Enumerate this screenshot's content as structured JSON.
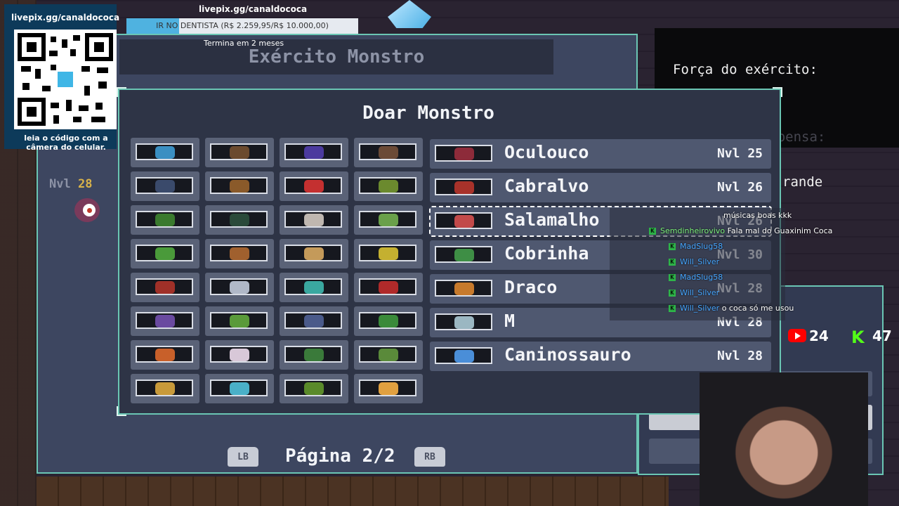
{
  "stream_overlay": {
    "qr_url": "livepix.gg/canaldococa",
    "qr_caption": "leia o código com a câmera do celular.",
    "goal_url": "livepix.gg/canaldococa",
    "goal_text": "IR NO DENTISTA (R$ 2.259,95/R$ 10.000,00)",
    "goal_progress": 0.226,
    "goal_ends": "Termina em 2 meses",
    "youtube_viewers": "24",
    "kick_viewers": "47",
    "colors": {
      "youtube": "#ff0000",
      "kick": "#53fc18",
      "goal_fill": "#4fb2e0"
    }
  },
  "chat": [
    {
      "user": "",
      "message": "músicas boas kkk"
    },
    {
      "user": "Semdinheirovivo",
      "message": "Fala mal do Guaxinim Coca"
    },
    {
      "user": "MadSlug58",
      "message": ""
    },
    {
      "user": "Will_Silver",
      "message": ""
    },
    {
      "user": "MadSlug58",
      "message": ""
    },
    {
      "user": "Will_Silver",
      "message": ""
    },
    {
      "user": "Will_Silver",
      "message": "o coca só me usou"
    }
  ],
  "game": {
    "outer_title": "Exército Monstro",
    "dialog_title": "Doar Monstro",
    "hero_level_label": "Nvl",
    "hero_level_value": "28",
    "page_label": "Página 2/2",
    "lb_label": "LB",
    "rb_label": "RB",
    "side_panel": {
      "force_label": "Força do exército:",
      "next_reward_label": "Próxima recompensa:",
      "partial_text": "rande"
    },
    "monster_list": [
      {
        "name": "Oculouco",
        "level": "Nvl 25",
        "color": "#8d2b3a"
      },
      {
        "name": "Cabralvo",
        "level": "Nvl 26",
        "color": "#a8322a"
      },
      {
        "name": "Salamalho",
        "level": "Nvl 26",
        "color": "#c24a4a"
      },
      {
        "name": "Cobrinha",
        "level": "Nvl 30",
        "color": "#3e8e45"
      },
      {
        "name": "Draco",
        "level": "Nvl 28",
        "color": "#c77a2c"
      },
      {
        "name": "M",
        "level": "Nvl 28",
        "color": "#9bb7c2"
      },
      {
        "name": "Caninossauro",
        "level": "Nvl 28",
        "color": "#4a8ed8"
      }
    ],
    "grid_sprites": [
      [
        "#3a8fc2",
        "#6b4a2e",
        "#4b3a9e",
        "#6b4a36"
      ],
      [
        "#3a4a6b",
        "#8a5a2a",
        "#c43030",
        "#6b8a2e"
      ],
      [
        "#3a7a2e",
        "#2a4a3a",
        "#bfb7b0",
        "#6aa04a"
      ],
      [
        "#4a9a3a",
        "#a0602e",
        "#c49a5a",
        "#c4b030"
      ],
      [
        "#a03028",
        "#b0b8c8",
        "#3aa8a0",
        "#b02a2a"
      ],
      [
        "#6a4aa0",
        "#5a9a3a",
        "#4a5a8a",
        "#3a8a3a"
      ],
      [
        "#c8602a",
        "#d8c8d8",
        "#3a7a3a",
        "#5a8a3a"
      ],
      [
        "#c89a3a",
        "#4ab0c8",
        "#5a8a2a",
        "#e0a040"
      ]
    ]
  }
}
